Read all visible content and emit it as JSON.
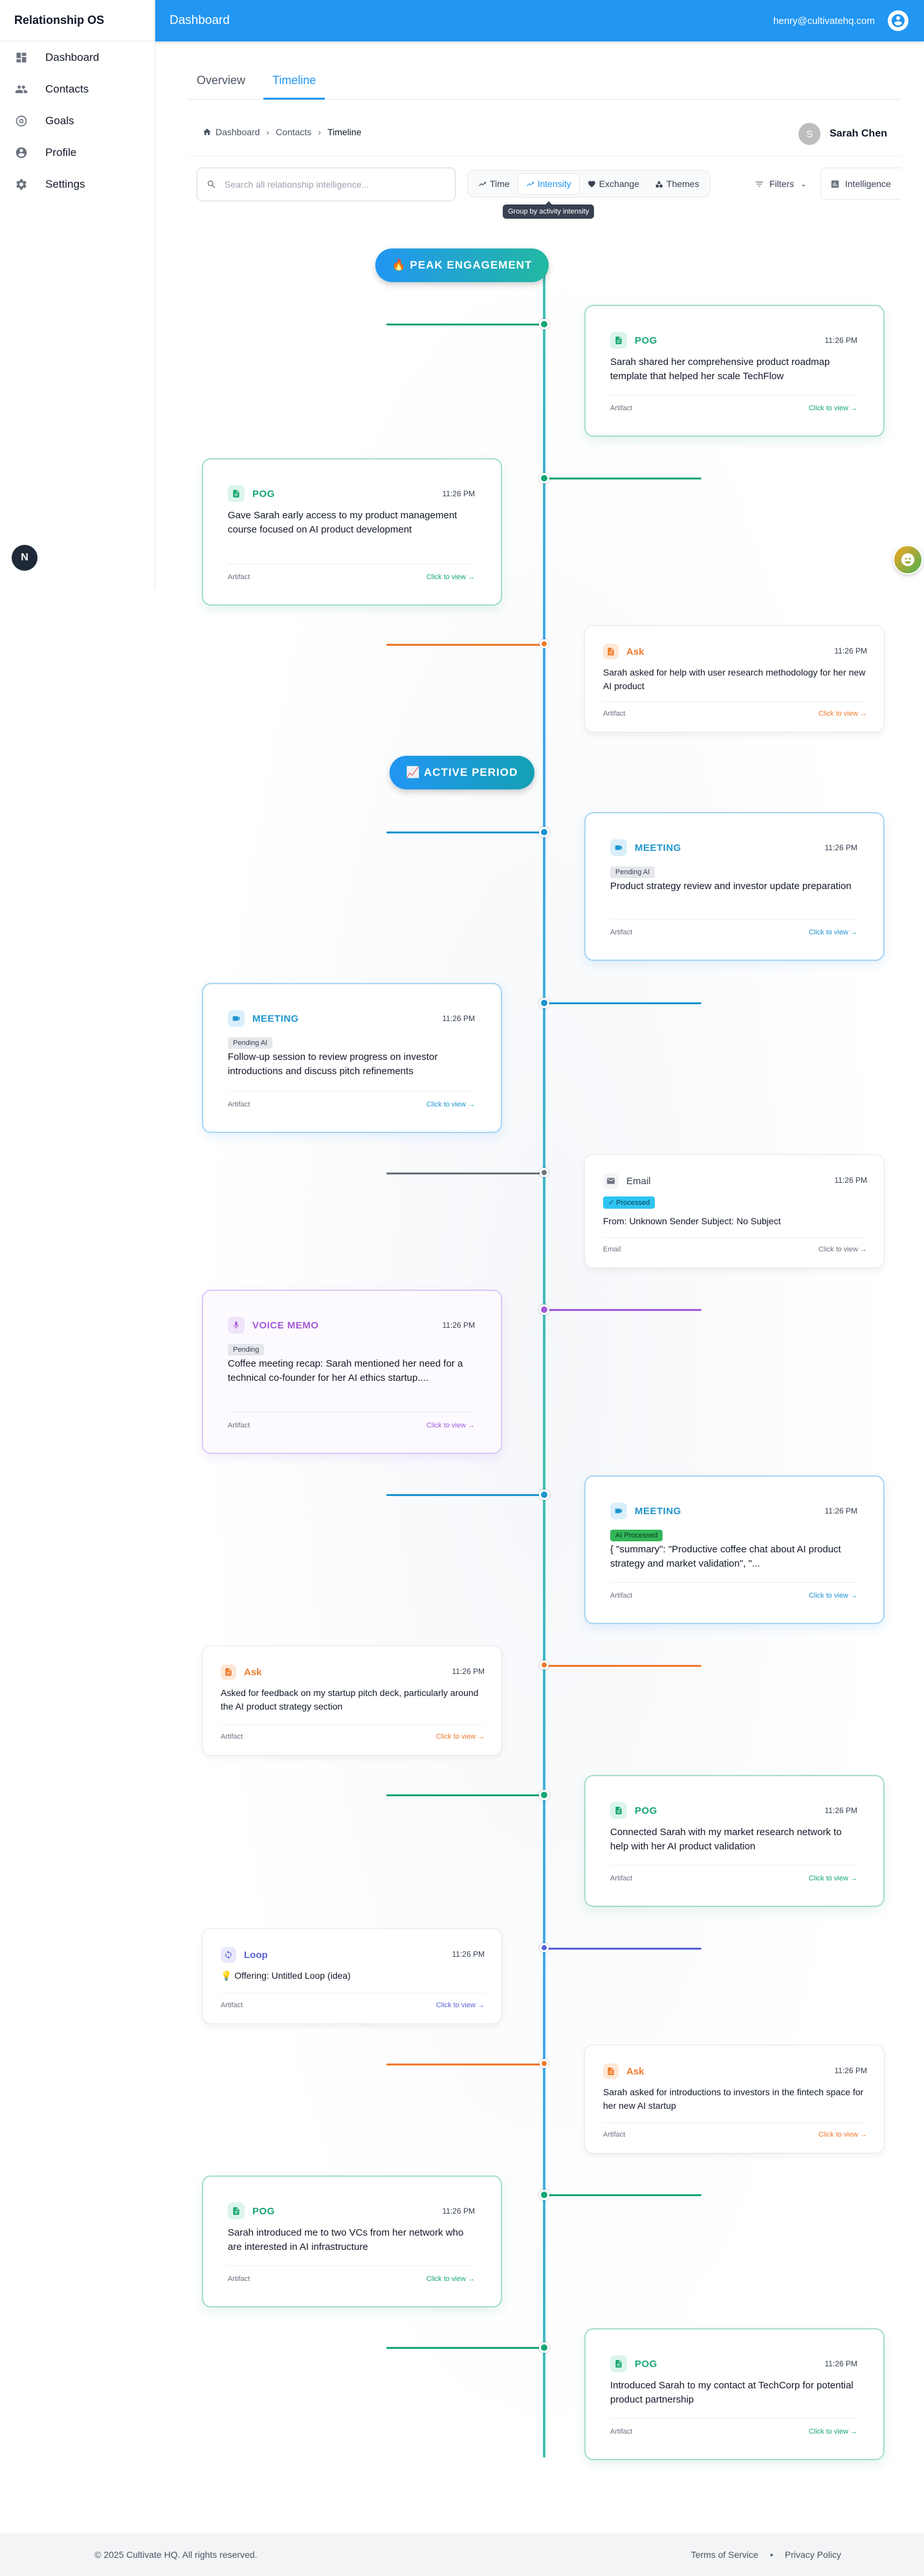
{
  "app": {
    "name": "Relationship OS"
  },
  "sidebar": {
    "items": [
      {
        "label": "Dashboard",
        "icon": "dashboard-icon"
      },
      {
        "label": "Contacts",
        "icon": "people-icon"
      },
      {
        "label": "Goals",
        "icon": "target-icon"
      },
      {
        "label": "Profile",
        "icon": "account-circle-icon"
      },
      {
        "label": "Settings",
        "icon": "gear-icon"
      }
    ]
  },
  "topbar": {
    "title": "Dashboard",
    "email": "henry@cultivatehq.com"
  },
  "tabs": [
    {
      "label": "Overview"
    },
    {
      "label": "Timeline"
    }
  ],
  "breadcrumb": {
    "home": "Dashboard",
    "contacts": "Contacts",
    "current": "Timeline"
  },
  "contact": {
    "initial": "S",
    "name": "Sarah Chen"
  },
  "toolbar": {
    "search_placeholder": "Search all relationship intelligence...",
    "views": [
      "Time",
      "Intensity",
      "Exchange",
      "Themes"
    ],
    "active_view": "Intensity",
    "tooltip": "Group by activity intensity",
    "filters": "Filters",
    "intelligence": "Intelligence"
  },
  "timeline": {
    "peak_label": "🔥 PEAK ENGAGEMENT",
    "active_label": "📈 ACTIVE PERIOD",
    "cards": [
      {
        "type": "POG",
        "time": "11:26 PM",
        "text": "Sarah shared her comprehensive product roadmap template that helped her scale TechFlow",
        "foot": "Artifact",
        "link": "Click to view →"
      },
      {
        "type": "POG",
        "time": "11:26 PM",
        "text": "Gave Sarah early access to my product management course focused on AI product development",
        "foot": "Artifact",
        "link": "Click to view →"
      },
      {
        "type": "Ask",
        "time": "11:26 PM",
        "text": "Sarah asked for help with user research methodology for her new AI product",
        "foot": "Artifact",
        "link": "Click to view →"
      },
      {
        "type": "MEETING",
        "time": "11:26 PM",
        "badge": "Pending AI",
        "text": "Product strategy review and investor update preparation",
        "foot": "Artifact",
        "link": "Click to view →"
      },
      {
        "type": "MEETING",
        "time": "11:26 PM",
        "badge": "Pending AI",
        "text": "Follow-up session to review progress on investor introductions and discuss pitch refinements",
        "foot": "Artifact",
        "link": "Click to view →"
      },
      {
        "type": "Email",
        "time": "11:26 PM",
        "badge": "Processed",
        "text": "From: Unknown Sender Subject: No Subject",
        "foot": "Email",
        "link": "Click to view →"
      },
      {
        "type": "VOICE MEMO",
        "time": "11:26 PM",
        "badge": "Pending",
        "text": "Coffee meeting recap: Sarah mentioned her need for a technical co-founder for her AI ethics startup....",
        "foot": "Artifact",
        "link": "Click to view →"
      },
      {
        "type": "MEETING",
        "time": "11:26 PM",
        "badge": "AI Processed",
        "text": "{ \"summary\": \"Productive coffee chat about AI product strategy and market validation\", \"...",
        "foot": "Artifact",
        "link": "Click to view →"
      },
      {
        "type": "Ask",
        "time": "11:26 PM",
        "text": "Asked for feedback on my startup pitch deck, particularly around the AI product strategy section",
        "foot": "Artifact",
        "link": "Click to view →"
      },
      {
        "type": "POG",
        "time": "11:26 PM",
        "text": "Connected Sarah with my market research network to help with her AI product validation",
        "foot": "Artifact",
        "link": "Click to view →"
      },
      {
        "type": "Loop",
        "time": "11:26 PM",
        "text": "💡 Offering: Untitled Loop (idea)",
        "foot": "Artifact",
        "link": "Click to view →"
      },
      {
        "type": "Ask",
        "time": "11:26 PM",
        "text": "Sarah asked for introductions to investors in the fintech space for her new AI startup",
        "foot": "Artifact",
        "link": "Click to view →"
      },
      {
        "type": "POG",
        "time": "11:26 PM",
        "text": "Sarah introduced me to two VCs from her network who are interested in AI infrastructure",
        "foot": "Artifact",
        "link": "Click to view →"
      },
      {
        "type": "POG",
        "time": "11:26 PM",
        "text": "Introduced Sarah to my contact at TechCorp for potential product partnership",
        "foot": "Artifact",
        "link": "Click to view →"
      }
    ]
  },
  "fab": {
    "left_label": "N"
  },
  "footer": {
    "copyright": "© 2025 Cultivate HQ. All rights reserved.",
    "terms": "Terms of Service",
    "sep": "•",
    "privacy": "Privacy Policy"
  },
  "colors": {
    "primary": "#2196f3",
    "pog": "#17a673",
    "ask": "#ef7a2c",
    "meeting": "#1e95cf",
    "voice": "#a35ad8",
    "loop": "#5b63d6"
  }
}
